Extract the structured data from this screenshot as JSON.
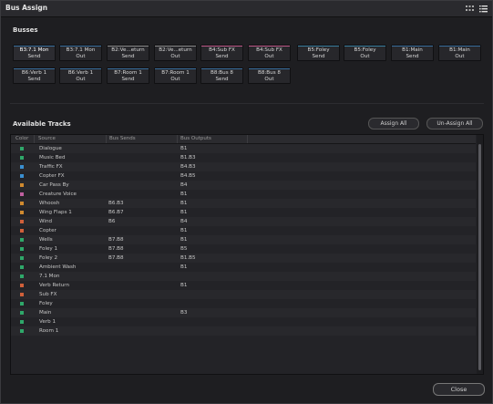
{
  "window": {
    "title": "Bus Assign"
  },
  "icons": {
    "grid": "grid-view-icon",
    "list": "list-view-icon"
  },
  "busses_section": {
    "label": "Busses"
  },
  "busses": [
    {
      "line1": "B3:7.1 Mon",
      "line2": "Send",
      "color": "#3a6f9e",
      "selected": true
    },
    {
      "line1": "B3:7.1 Mon",
      "line2": "Out",
      "color": "#3a6f9e",
      "selected": false
    },
    {
      "line1": "B2:Ve...eturn",
      "line2": "Send",
      "color": "#8a8a8a",
      "selected": false
    },
    {
      "line1": "B2:Ve...eturn",
      "line2": "Out",
      "color": "#8a8a8a",
      "selected": false
    },
    {
      "line1": "B4:Sub FX",
      "line2": "Send",
      "color": "#c05a8a",
      "selected": false
    },
    {
      "line1": "B4:Sub FX",
      "line2": "Out",
      "color": "#c05a8a",
      "selected": false
    },
    {
      "line1": "B5:Foley",
      "line2": "Send",
      "color": "#3a7fa0",
      "selected": false
    },
    {
      "line1": "B5:Foley",
      "line2": "Out",
      "color": "#3a7fa0",
      "selected": false
    },
    {
      "line1": "B1:Main",
      "line2": "Send",
      "color": "#3a6f9e",
      "selected": false
    },
    {
      "line1": "B1:Main",
      "line2": "Out",
      "color": "#3a6f9e",
      "selected": false
    },
    {
      "line1": "B6:Verb 1",
      "line2": "Send",
      "color": "#3a6f9e",
      "selected": false
    },
    {
      "line1": "B6:Verb 1",
      "line2": "Out",
      "color": "#3a6f9e",
      "selected": false
    },
    {
      "line1": "B7:Room 1",
      "line2": "Send",
      "color": "#3a6f9e",
      "selected": false
    },
    {
      "line1": "B7:Room 1",
      "line2": "Out",
      "color": "#3a6f9e",
      "selected": false
    },
    {
      "line1": "B8:Bus 8",
      "line2": "Send",
      "color": "#3a6f9e",
      "selected": false
    },
    {
      "line1": "B8:Bus 8",
      "line2": "Out",
      "color": "#3a6f9e",
      "selected": false
    }
  ],
  "tracks_section": {
    "label": "Available Tracks",
    "assign_all": "Assign All",
    "unassign_all": "Un-Assign All"
  },
  "table": {
    "columns": [
      "Color",
      "Source",
      "Bus Sends",
      "Bus Outputs"
    ],
    "rows": [
      {
        "color": "#2fa86a",
        "source": "Dialogue",
        "sends": "",
        "outputs": "B1"
      },
      {
        "color": "#2fa86a",
        "source": "Music Bed",
        "sends": "",
        "outputs": "B1.B3"
      },
      {
        "color": "#3a8fd0",
        "source": "Traffic FX",
        "sends": "",
        "outputs": "B4.B3"
      },
      {
        "color": "#3a8fd0",
        "source": "Copter FX",
        "sends": "",
        "outputs": "B4.B5"
      },
      {
        "color": "#d08a2f",
        "source": "Car Pass By",
        "sends": "",
        "outputs": "B4"
      },
      {
        "color": "#c060a0",
        "source": "Creature Voice",
        "sends": "",
        "outputs": "B1"
      },
      {
        "color": "#d08a2f",
        "source": "Whoosh",
        "sends": "B6.B3",
        "outputs": "B1"
      },
      {
        "color": "#d08a2f",
        "source": "Wing Flaps 1",
        "sends": "B6.B7",
        "outputs": "B1"
      },
      {
        "color": "#d0603a",
        "source": "Wind",
        "sends": "B6",
        "outputs": "B4"
      },
      {
        "color": "#d0603a",
        "source": "Copter",
        "sends": "",
        "outputs": "B1"
      },
      {
        "color": "#2fa86a",
        "source": "Wells",
        "sends": "B7.B8",
        "outputs": "B1"
      },
      {
        "color": "#2fa86a",
        "source": "Foley 1",
        "sends": "B7.B8",
        "outputs": "B5"
      },
      {
        "color": "#2fa86a",
        "source": "Foley 2",
        "sends": "B7.B8",
        "outputs": "B1.B5"
      },
      {
        "color": "#2fa86a",
        "source": "Ambient Wash",
        "sends": "",
        "outputs": "B1"
      },
      {
        "color": "#2fa86a",
        "source": "7.1 Mon",
        "sends": "",
        "outputs": ""
      },
      {
        "color": "#d0603a",
        "source": "Verb Return",
        "sends": "",
        "outputs": "B1"
      },
      {
        "color": "#d0603a",
        "source": "Sub FX",
        "sends": "",
        "outputs": ""
      },
      {
        "color": "#2fa86a",
        "source": "Foley",
        "sends": "",
        "outputs": ""
      },
      {
        "color": "#2fa86a",
        "source": "Main",
        "sends": "",
        "outputs": "B3"
      },
      {
        "color": "#2fa86a",
        "source": "Verb 1",
        "sends": "",
        "outputs": ""
      },
      {
        "color": "#2fa86a",
        "source": "Room 1",
        "sends": "",
        "outputs": ""
      }
    ]
  },
  "footer": {
    "close": "Close"
  }
}
